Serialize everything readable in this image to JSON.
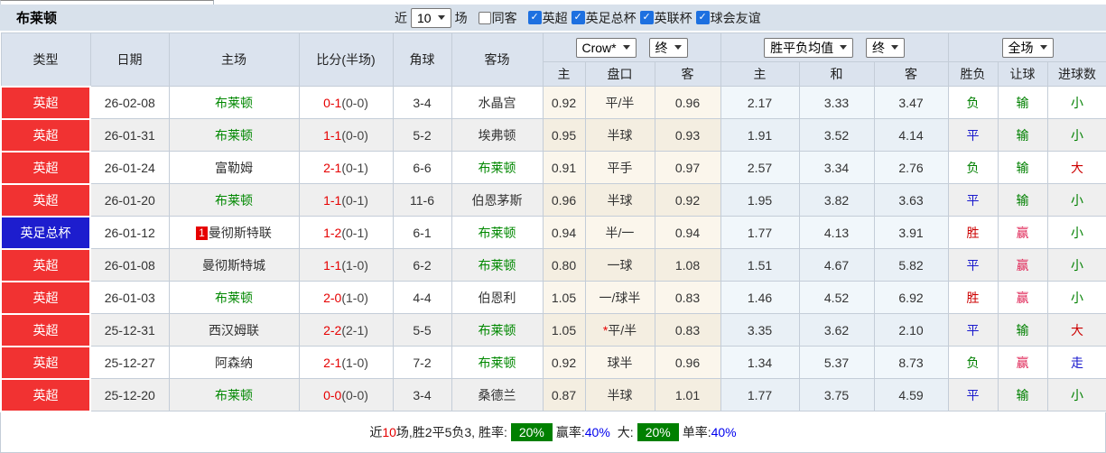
{
  "title": "布莱顿",
  "toolbar": {
    "recent_label": "近",
    "recent_value": "10",
    "unit_label": "场",
    "same_away_label": "同客",
    "league_filters": [
      "英超",
      "英足总杯",
      "英联杯",
      "球会友谊"
    ]
  },
  "table_header": {
    "type": "类型",
    "date": "日期",
    "home": "主场",
    "score": "比分(半场)",
    "corner": "角球",
    "away": "客场",
    "odds_selects": [
      "Crow*",
      "终"
    ],
    "avg_selects": [
      "胜平负均值",
      "终"
    ],
    "period_select": "全场",
    "sub": [
      "主",
      "盘口",
      "客",
      "主",
      "和",
      "客",
      "胜负",
      "让球",
      "进球数"
    ]
  },
  "rows": [
    {
      "league": "英超",
      "league_class": "badge-red",
      "date": "26-02-08",
      "home_badge": "",
      "home": "布莱顿",
      "home_class": "team-green",
      "score": "0-1",
      "half": "(0-0)",
      "corner": "3-4",
      "away": "水晶宫",
      "away_class": "",
      "o1": "0.92",
      "pan_star": "",
      "pan": "平/半",
      "o2": "0.96",
      "a1": "2.17",
      "a2": "3.33",
      "a3": "3.47",
      "r1": "负",
      "r1c": "c-green",
      "r2": "输",
      "r2c": "c-green",
      "r3": "小",
      "r3c": "c-green"
    },
    {
      "league": "英超",
      "league_class": "badge-red",
      "date": "26-01-31",
      "home_badge": "",
      "home": "布莱顿",
      "home_class": "team-green",
      "score": "1-1",
      "half": "(0-0)",
      "corner": "5-2",
      "away": "埃弗顿",
      "away_class": "",
      "o1": "0.95",
      "pan_star": "",
      "pan": "半球",
      "o2": "0.93",
      "a1": "1.91",
      "a2": "3.52",
      "a3": "4.14",
      "r1": "平",
      "r1c": "c-blue",
      "r2": "输",
      "r2c": "c-green",
      "r3": "小",
      "r3c": "c-green"
    },
    {
      "league": "英超",
      "league_class": "badge-red",
      "date": "26-01-24",
      "home_badge": "",
      "home": "富勒姆",
      "home_class": "",
      "score": "2-1",
      "half": "(0-1)",
      "corner": "6-6",
      "away": "布莱顿",
      "away_class": "team-green",
      "o1": "0.91",
      "pan_star": "",
      "pan": "平手",
      "o2": "0.97",
      "a1": "2.57",
      "a2": "3.34",
      "a3": "2.76",
      "r1": "负",
      "r1c": "c-green",
      "r2": "输",
      "r2c": "c-green",
      "r3": "大",
      "r3c": "c-red"
    },
    {
      "league": "英超",
      "league_class": "badge-red",
      "date": "26-01-20",
      "home_badge": "",
      "home": "布莱顿",
      "home_class": "team-green",
      "score": "1-1",
      "half": "(0-1)",
      "corner": "11-6",
      "away": "伯恩茅斯",
      "away_class": "",
      "o1": "0.96",
      "pan_star": "",
      "pan": "半球",
      "o2": "0.92",
      "a1": "1.95",
      "a2": "3.82",
      "a3": "3.63",
      "r1": "平",
      "r1c": "c-blue",
      "r2": "输",
      "r2c": "c-green",
      "r3": "小",
      "r3c": "c-green"
    },
    {
      "league": "英足总杯",
      "league_class": "badge-blue",
      "date": "26-01-12",
      "home_badge": "1",
      "home": "曼彻斯特联",
      "home_class": "",
      "score": "1-2",
      "half": "(0-1)",
      "corner": "6-1",
      "away": "布莱顿",
      "away_class": "team-green",
      "o1": "0.94",
      "pan_star": "",
      "pan": "半/一",
      "o2": "0.94",
      "a1": "1.77",
      "a2": "4.13",
      "a3": "3.91",
      "r1": "胜",
      "r1c": "c-red",
      "r2": "赢",
      "r2c": "c-crimson",
      "r3": "小",
      "r3c": "c-green"
    },
    {
      "league": "英超",
      "league_class": "badge-red",
      "date": "26-01-08",
      "home_badge": "",
      "home": "曼彻斯特城",
      "home_class": "",
      "score": "1-1",
      "half": "(1-0)",
      "corner": "6-2",
      "away": "布莱顿",
      "away_class": "team-green",
      "o1": "0.80",
      "pan_star": "",
      "pan": "一球",
      "o2": "1.08",
      "a1": "1.51",
      "a2": "4.67",
      "a3": "5.82",
      "r1": "平",
      "r1c": "c-blue",
      "r2": "赢",
      "r2c": "c-crimson",
      "r3": "小",
      "r3c": "c-green"
    },
    {
      "league": "英超",
      "league_class": "badge-red",
      "date": "26-01-03",
      "home_badge": "",
      "home": "布莱顿",
      "home_class": "team-green",
      "score": "2-0",
      "half": "(1-0)",
      "corner": "4-4",
      "away": "伯恩利",
      "away_class": "",
      "o1": "1.05",
      "pan_star": "",
      "pan": "一/球半",
      "o2": "0.83",
      "a1": "1.46",
      "a2": "4.52",
      "a3": "6.92",
      "r1": "胜",
      "r1c": "c-red",
      "r2": "赢",
      "r2c": "c-crimson",
      "r3": "小",
      "r3c": "c-green"
    },
    {
      "league": "英超",
      "league_class": "badge-red",
      "date": "25-12-31",
      "home_badge": "",
      "home": "西汉姆联",
      "home_class": "",
      "score": "2-2",
      "half": "(2-1)",
      "corner": "5-5",
      "away": "布莱顿",
      "away_class": "team-green",
      "o1": "1.05",
      "pan_star": "*",
      "pan": "平/半",
      "o2": "0.83",
      "a1": "3.35",
      "a2": "3.62",
      "a3": "2.10",
      "r1": "平",
      "r1c": "c-blue",
      "r2": "输",
      "r2c": "c-green",
      "r3": "大",
      "r3c": "c-red"
    },
    {
      "league": "英超",
      "league_class": "badge-red",
      "date": "25-12-27",
      "home_badge": "",
      "home": "阿森纳",
      "home_class": "",
      "score": "2-1",
      "half": "(1-0)",
      "corner": "7-2",
      "away": "布莱顿",
      "away_class": "team-green",
      "o1": "0.92",
      "pan_star": "",
      "pan": "球半",
      "o2": "0.96",
      "a1": "1.34",
      "a2": "5.37",
      "a3": "8.73",
      "r1": "负",
      "r1c": "c-green",
      "r2": "赢",
      "r2c": "c-crimson",
      "r3": "走",
      "r3c": "c-blue"
    },
    {
      "league": "英超",
      "league_class": "badge-red",
      "date": "25-12-20",
      "home_badge": "",
      "home": "布莱顿",
      "home_class": "team-green",
      "score": "0-0",
      "half": "(0-0)",
      "corner": "3-4",
      "away": "桑德兰",
      "away_class": "",
      "o1": "0.87",
      "pan_star": "",
      "pan": "半球",
      "o2": "1.01",
      "a1": "1.77",
      "a2": "3.75",
      "a3": "4.59",
      "r1": "平",
      "r1c": "c-blue",
      "r2": "输",
      "r2c": "c-green",
      "r3": "小",
      "r3c": "c-green"
    }
  ],
  "footer": {
    "recent_label": "近",
    "recent_count": "10",
    "record_text": "场,胜2平5负3, 胜率:",
    "win_rate": "20%",
    "handicap_label": "赢率:",
    "handicap_rate": "40%",
    "big_label": "大:",
    "big_rate": "20%",
    "single_label": "单率:",
    "single_rate": "40%"
  },
  "icons": {
    "checkbox_check": "✓"
  },
  "colors": {
    "league_red": "#f13232",
    "cup_blue": "#1d1dce",
    "team_green": "#008800",
    "score_red": "#e60000",
    "win_red": "#cc0000",
    "draw_blue": "#1a1acd",
    "lose_green": "#008000",
    "crimson": "#e02a5a",
    "chip_green": "#008000",
    "rate_blue": "#0000ee",
    "odds_bg": "#fbf6ec",
    "avg_bg": "#f1f7fb"
  }
}
